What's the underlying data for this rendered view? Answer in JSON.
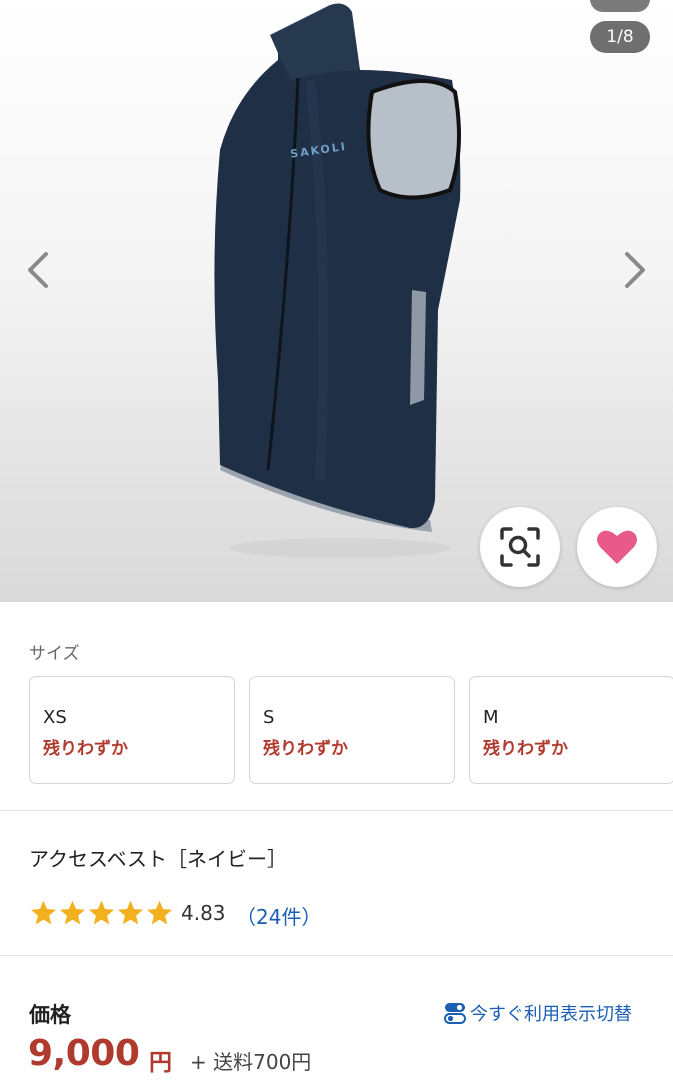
{
  "gallery": {
    "counter": "1/8",
    "brand_print": "SAKOLI"
  },
  "sizes": {
    "label": "サイズ",
    "options": [
      {
        "size": "XS",
        "stock": "残りわずか"
      },
      {
        "size": "S",
        "stock": "残りわずか"
      },
      {
        "size": "M",
        "stock": "残りわずか"
      }
    ]
  },
  "product": {
    "name": "アクセスベスト［ネイビー］",
    "rating_value": "4.83",
    "rating_stars": 5,
    "review_count": "（24件）"
  },
  "price": {
    "heading": "価格",
    "toggle_label": "今すぐ利用表示切替",
    "amount": "9,000",
    "currency": "円",
    "shipping": "+ 送料700円"
  },
  "colors": {
    "accent_red": "#b03a2e",
    "link_blue": "#1a5fb4",
    "star_gold": "#f2b01e",
    "heart_pink": "#e75a8a",
    "vest_navy": "#1e2e44"
  },
  "icons": {
    "prev": "chevron-left-icon",
    "next": "chevron-right-icon",
    "zoom": "zoom-search-icon",
    "favorite": "heart-icon",
    "toggle": "toggle-icon",
    "star": "star-icon"
  }
}
